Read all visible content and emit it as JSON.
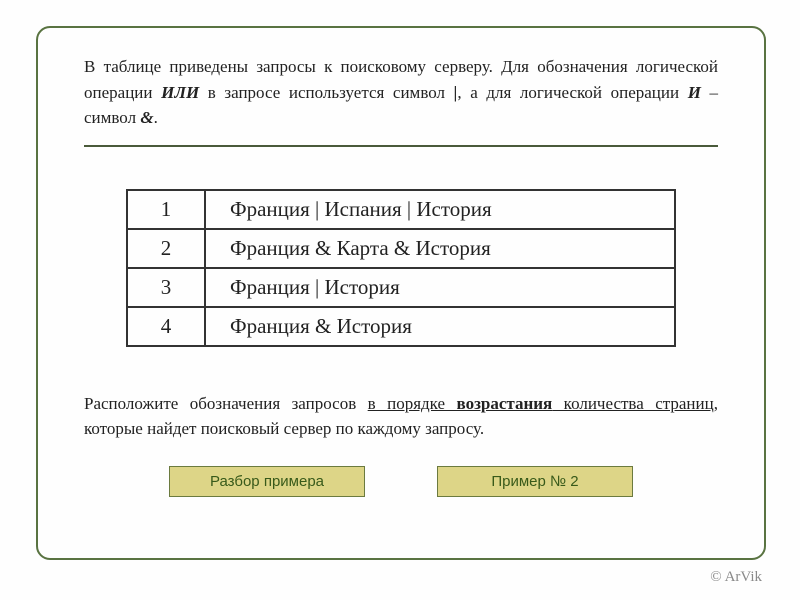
{
  "intro": {
    "part1": "В таблице приведены запросы к поисковому серверу. Для обозначения логической операции ",
    "kw_or": "ИЛИ",
    "part2": " в запросе используется символ ",
    "sym_or": "|",
    "part3": ", а для логической операции ",
    "kw_and": "И",
    "part4": " – символ ",
    "sym_and": "&",
    "part5": "."
  },
  "rows": [
    {
      "n": "1",
      "q": "Франция | Испания | История"
    },
    {
      "n": "2",
      "q": "Франция & Карта & История"
    },
    {
      "n": "3",
      "q": "Франция | История"
    },
    {
      "n": "4",
      "q": "Франция & История"
    }
  ],
  "outro": {
    "part1": "Расположите обозначения запросов ",
    "ul1": "в порядке ",
    "ul2_bold": "возрастания",
    "ul3": " количества страниц",
    "part2": ", которые найдет поисковый сервер по каждому запросу."
  },
  "buttons": {
    "analyze": "Разбор примера",
    "example2": "Пример № 2"
  },
  "copyright": "© ArVik"
}
